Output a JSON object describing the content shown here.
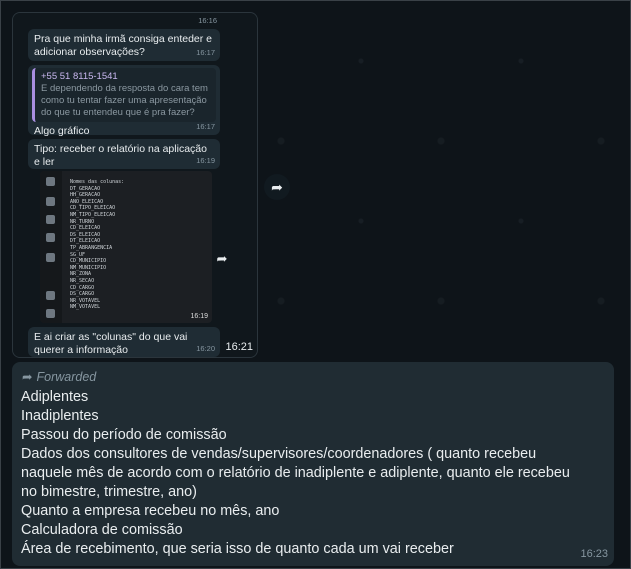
{
  "inner_chat": {
    "messages": [
      {
        "text": "Pra que minha irmã consiga enteder e adicionar observações?",
        "time": "16:17"
      },
      {
        "quote_author": "+55 51 8115-1541",
        "quote_text": "E dependendo da resposta do cara tem como tu tentar fazer uma apresentação do que tu entendeu que é pra fazer?",
        "text": "Algo gráfico",
        "time": "16:17"
      },
      {
        "text": "Tipo: receber o relatório na aplicação e ler",
        "time": "16:19"
      },
      {
        "text": "E ai criar as \"colunas\" do que vai querer a informação",
        "time": "16:20"
      }
    ],
    "top_time": "16:16",
    "code_image": {
      "lines": [
        "Nomes das colunas:",
        "DT_GERACAO",
        "HH_GERACAO",
        "ANO_ELEICAO",
        "CD_TIPO_ELEICAO",
        "NM_TIPO_ELEICAO",
        "NR_TURNO",
        "CD_ELEICAO",
        "DS_ELEICAO",
        "DT_ELEICAO",
        "TP_ABRANGENCIA",
        "SG_UF",
        "CD_MUNICIPIO",
        "NM_MUNICIPIO",
        "NR_ZONA",
        "NR_SECAO",
        "CD_CARGO",
        "DS_CARGO",
        "NR_VOTAVEL",
        "NM_VOTAVEL"
      ],
      "time": "16:19"
    },
    "screenshot_time": "16:21"
  },
  "message": {
    "forwarded_label": "Forwarded",
    "lines": [
      "Adiplentes",
      "Inadiplentes",
      "Passou do período de comissão",
      "Dados dos consultores de vendas/supervisores/coordenadores ( quanto recebeu",
      "naquele mês de acordo com o relatório de inadiplente e adiplente, quanto ele recebeu",
      "no bimestre, trimestre, ano)",
      "Quanto a empresa recebeu no mês, ano",
      "Calculadora de comissão",
      "Área de recebimento, que seria isso de quanto cada um vai receber"
    ],
    "time": "16:23"
  },
  "icons": {
    "forward": "forward-icon",
    "forwarded": "forwarded-arrow-icon"
  }
}
